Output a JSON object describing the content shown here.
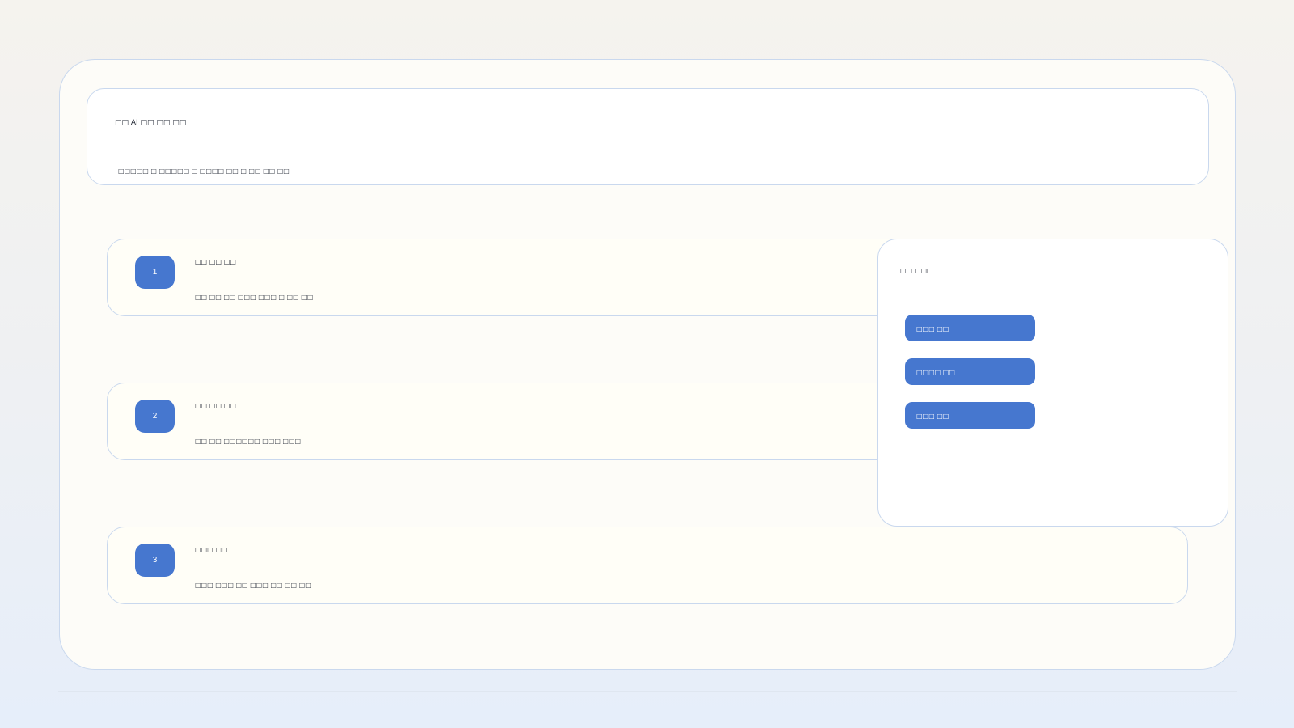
{
  "header": {
    "title": "□□ AI □□ □□ □□",
    "subtitle": "□□□□□ □ □□□□□ □ □□□□ □□ □ □□ □□ □□"
  },
  "steps": [
    {
      "number": "1",
      "title": "□□ □□ □□",
      "description": "□□ □□ □□ □□□ □□□ □ □□ □□"
    },
    {
      "number": "2",
      "title": "□□ □□ □□",
      "description": "□□ □□ □□□□□□ □□□ □□□"
    },
    {
      "number": "3",
      "title": "□□□ □□",
      "description": "□□□ □□□ □□ □□□ □□ □□ □□"
    }
  ],
  "side_panel": {
    "title": "□□ □□□",
    "buttons": [
      "□□□ □□",
      "□□□□ □□",
      "□□□ □□"
    ]
  },
  "colors": {
    "accent": "#4677cf",
    "border": "#c9d8ee",
    "card_background": "#fffef7",
    "panel_background": "#ffffff"
  }
}
